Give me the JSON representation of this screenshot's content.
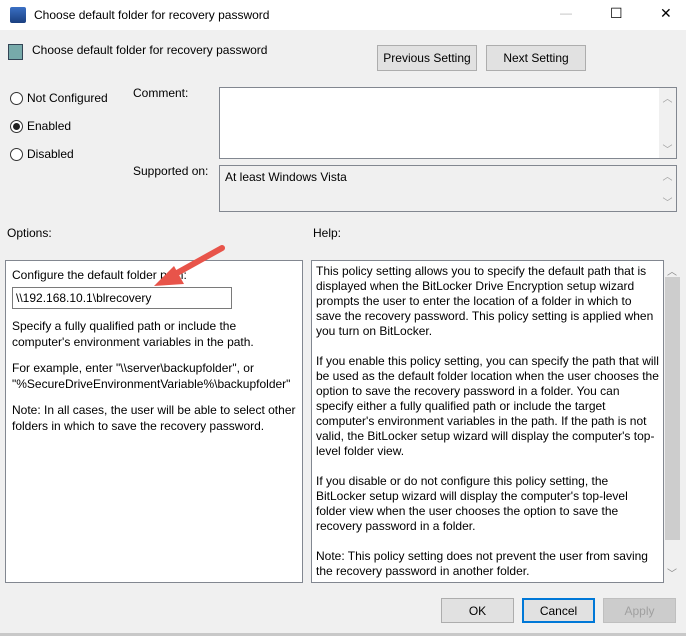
{
  "window": {
    "title": "Choose default folder for recovery password",
    "minimize": "—",
    "maximize": "☐",
    "close": "✕"
  },
  "header": {
    "title": "Choose default folder for recovery password",
    "prev": "Previous Setting",
    "next": "Next Setting"
  },
  "state": {
    "options": [
      {
        "label": "Not Configured",
        "selected": false
      },
      {
        "label": "Enabled",
        "selected": true
      },
      {
        "label": "Disabled",
        "selected": false
      }
    ]
  },
  "comment": {
    "label": "Comment:",
    "value": ""
  },
  "supported": {
    "label": "Supported on:",
    "value": "At least Windows Vista"
  },
  "options_label": "Options:",
  "help_label": "Help:",
  "options": {
    "field_label": "Configure the default folder path:",
    "path_value": "\\\\192.168.10.1\\blrecovery",
    "p1": "Specify a fully qualified path or include the computer's environment variables in the path.",
    "p2": "For example, enter \"\\\\server\\backupfolder\", or \"%SecureDriveEnvironmentVariable%\\backupfolder\"",
    "p3": "Note: In all cases, the user will be able to select other folders in which to save the recovery password."
  },
  "help": [
    "This policy setting allows you to specify the default path that is displayed when the BitLocker Drive Encryption setup wizard prompts the user to enter the location of a folder in which to save the recovery password. This policy setting is applied when you turn on BitLocker.",
    "If you enable this policy setting, you can specify the path that will be used as the default folder location when the user chooses the option to save the recovery password in a folder. You can specify either a fully qualified path or include the target computer's environment variables in the path. If the path is not valid, the BitLocker setup wizard will display the computer's top-level folder view.",
    "If you disable or do not configure this policy setting, the BitLocker setup wizard will display the computer's top-level folder view when the user chooses the option to save the recovery password in a folder.",
    "Note: This policy setting does not prevent the user from saving the recovery password in another folder."
  ],
  "footer": {
    "ok": "OK",
    "cancel": "Cancel",
    "apply": "Apply"
  },
  "colors": {
    "accent": "#0078d7",
    "arrow": "#e8544a"
  }
}
